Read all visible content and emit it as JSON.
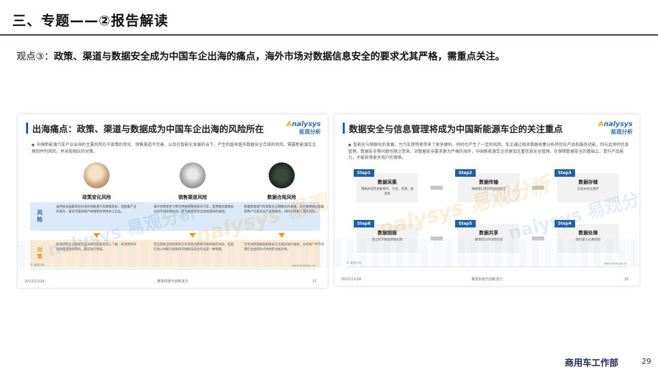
{
  "header": {
    "title": "三、专题——②报告解读"
  },
  "viewpoint": {
    "prefix": "观点③：",
    "text": "政策、渠道与数据安全成为中国车企出海的痛点，海外市场对数据信息安全的要求尤其严格，需重点关注。"
  },
  "slide_left": {
    "title": "出海痛点：政策、渠道与数据成为中国车企出海的风险所在",
    "logo_text": "nalysys",
    "logo_sub": "易观分析",
    "intro": "中国新能源汽车产业出海的主要风险在于政策的变化、销售渠道不完善，以及在智能化发展的当下，产生的越来越多数据安全合规的风险。需要新能源车企理到并判风险，并采取相应的对策。",
    "columns": [
      {
        "name": "政策变化风险",
        "icon": "policy-document-icon",
        "risk": "虽然很多国家目前对海外新能源汽车政策友好，但随着产业的提升，很有可能采取严格限制的特性本土企业。",
        "plan": "新能源车企业需要对出海目的国家有深入了解，并且预判评估政策变动的风险，提前进行预案。"
      },
      {
        "name": "销售渠道风险",
        "icon": "sales-channel-icon",
        "risk": "海外消费者更习惯于传统经销商购买汽车，直营模式需要较长的市场培育时间，且可能会受到当地经销商的抵制。",
        "plan": "完全保障当地经销商合作或者消费者带来新鲜的体验，但是在进入时期与经销商的销售渠道合作也是一种策略。"
      },
      {
        "name": "数据合规风险",
        "icon": "data-compliance-icon",
        "risk": "随着新能源汽车智能化与网联化的发展，车企需要通过收集到用户信息优化产品和服务，同时也带来了潜在风险。",
        "plan": "可考虑物理数据脱敏安全合规的进行规划，分析每个环节的潜在合规风险点并制定合规对策。"
      }
    ],
    "band_risk_label": "风险",
    "band_plan_label": "对策",
    "source": "© 易观分析",
    "url": "www.analysys.cn",
    "date": "2022/11/24",
    "mid": "数发科技与创新活力",
    "page": "17",
    "watermark": "nalysys 易观分析"
  },
  "slide_right": {
    "title": "数据安全与信息管理将成为中国新能源车企的关注重点",
    "logo_text": "nalysys",
    "logo_sub": "易观分析",
    "intro": "智能化与网联化的发展，为汽车使用者带来了更多便利，同时也产生了一定的风险。车企通过相关数据收集分析将优化产品和服务功能，但与此同时信息管理、数据安全等问题也随之而来。对数据安全要求更为严格的海外，中国新能源车企须更加注重信息安全管理，在保障数据安全的基础上，提升产品能力，才能获得更多用户的青睐。",
    "steps": [
      {
        "tag": "Step1",
        "title": "数据采集",
        "desc": "明确并规范采集目的、方式、范围、渠道等"
      },
      {
        "tag": "Step2",
        "title": "数据传输",
        "desc": "确保接口管控和加固安全"
      },
      {
        "tag": "Step3",
        "title": "数据存储",
        "desc": "实现本地化储存"
      },
      {
        "tag": "Step4",
        "title": "数据处理",
        "desc": "践行最小必要原则"
      },
      {
        "tag": "Step5",
        "title": "数据共享",
        "desc": "确保风险评估和检测"
      },
      {
        "tag": "Step6",
        "title": "数据销毁",
        "desc": "建立科学数据销毁机制"
      }
    ],
    "source": "© 易观分析",
    "url": "www.analysys.cn",
    "date": "2022/11/24",
    "mid": "数发科技与创新活力",
    "page": "25",
    "watermark": "nalysys 易观分析"
  },
  "footer": {
    "department": "商用车工作部",
    "page": "29"
  },
  "colors": {
    "accent": "#1f5fa8",
    "orange": "#f39a1c",
    "title_line": "#2b3a67"
  }
}
